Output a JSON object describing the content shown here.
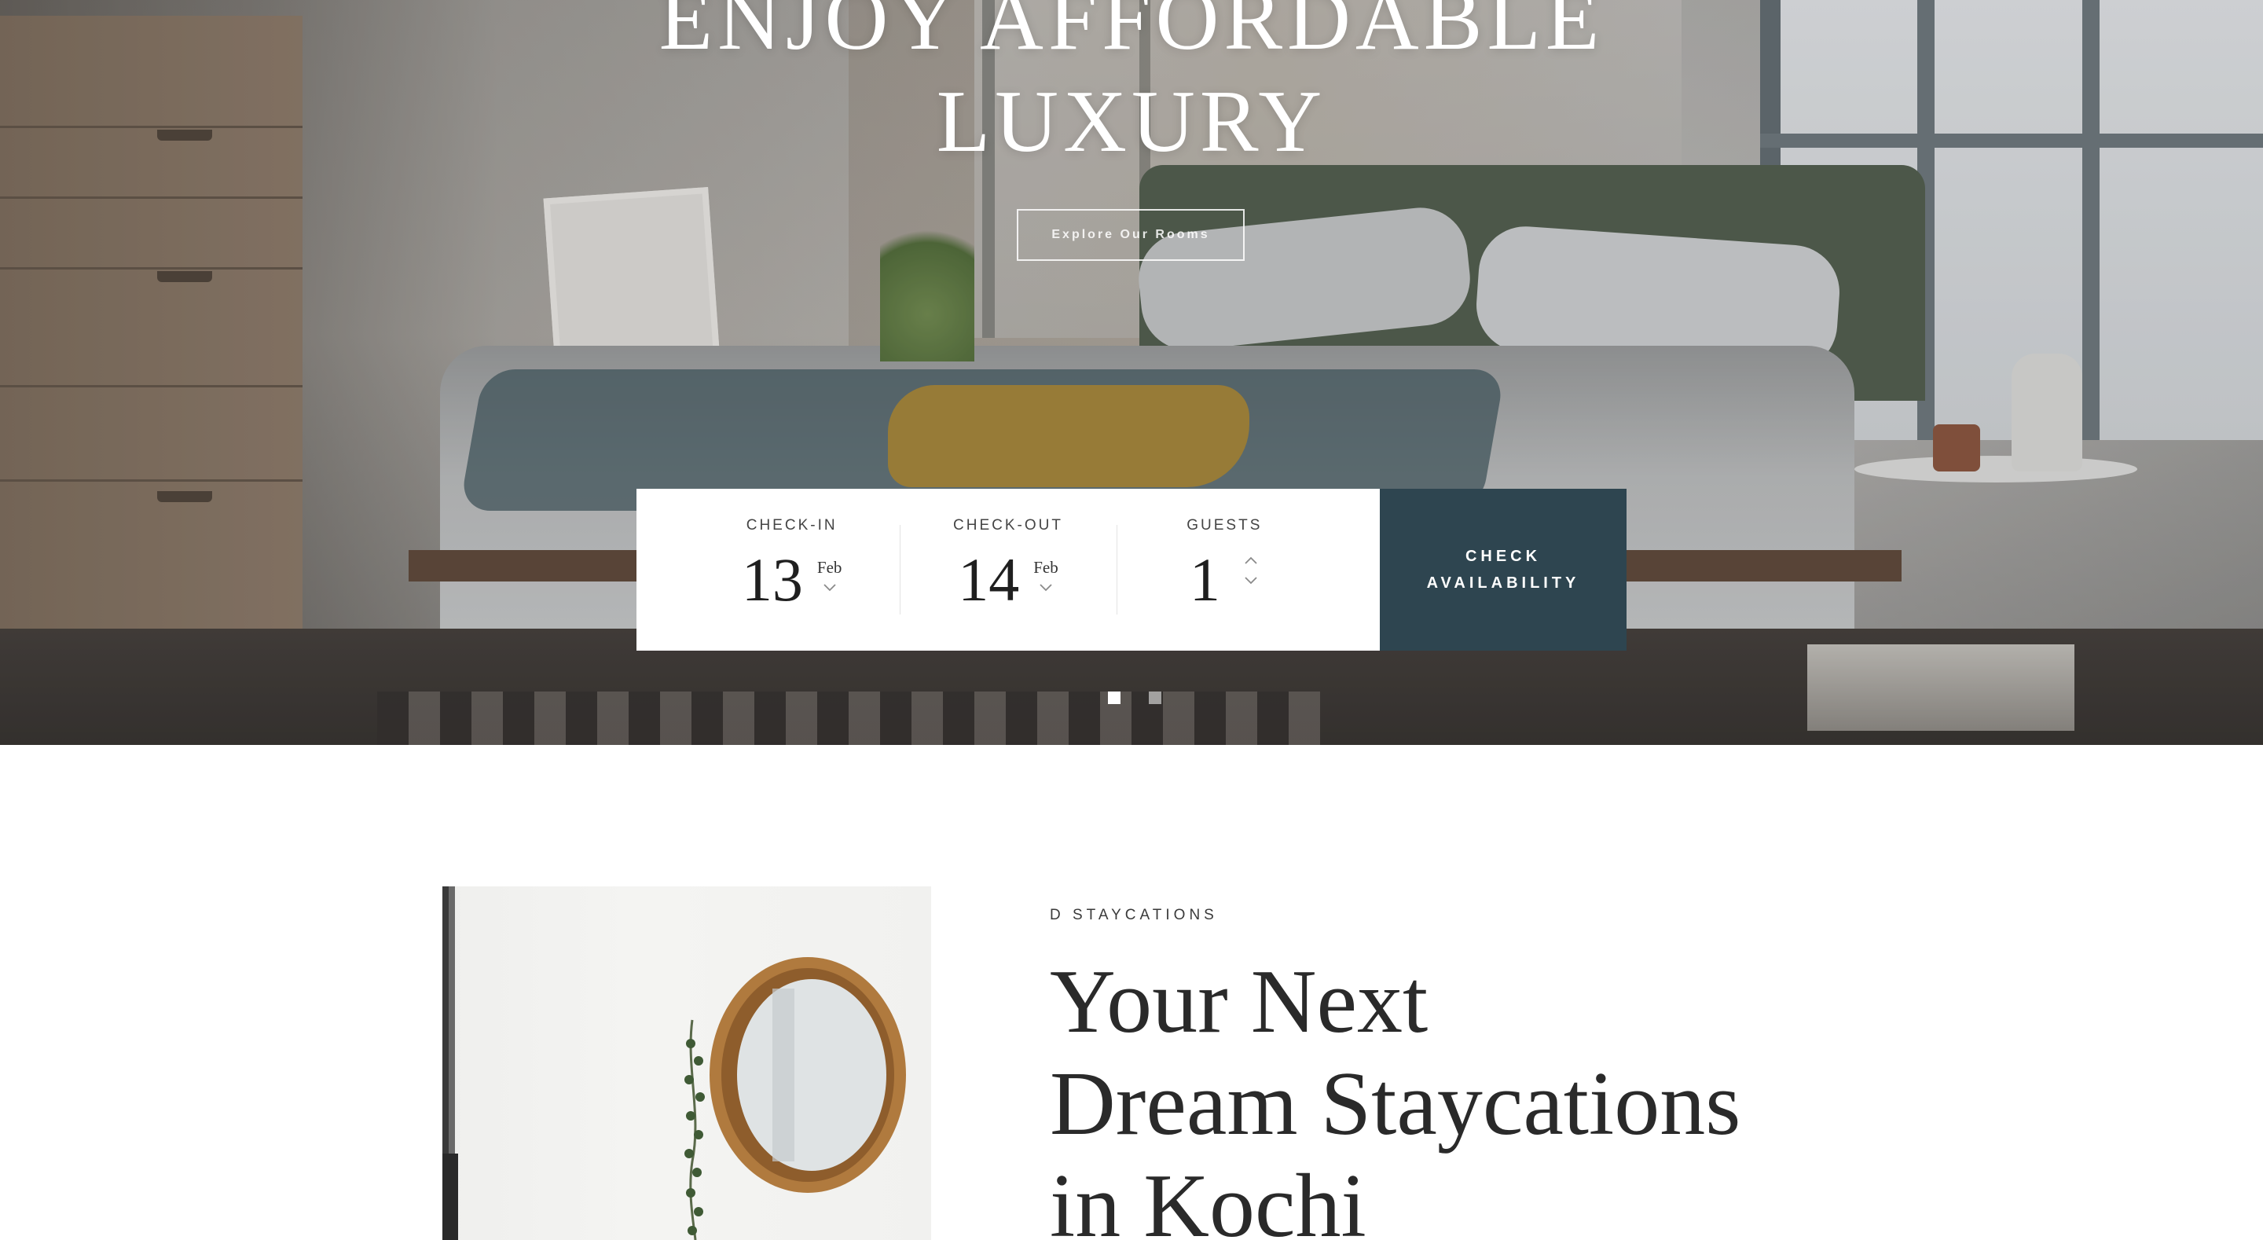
{
  "hero": {
    "title_line1": "ENJOY AFFORDABLE",
    "title_line2": "LUXURY",
    "explore_label": "Explore Our Rooms",
    "slides": {
      "count": 2,
      "active_index": 0
    }
  },
  "booking": {
    "checkin": {
      "label": "CHECK-IN",
      "day": "13",
      "month": "Feb"
    },
    "checkout": {
      "label": "CHECK-OUT",
      "day": "14",
      "month": "Feb"
    },
    "guests": {
      "label": "GUESTS",
      "value": "1"
    },
    "button_line1": "CHECK",
    "button_line2": "AVAILABILITY"
  },
  "about": {
    "eyebrow": "D STAYCATIONS",
    "heading_line1": "Your Next",
    "heading_line2": "Dream Staycations",
    "heading_line3": "in Kochi"
  },
  "colors": {
    "accent": "#2e4550",
    "white": "#ffffff",
    "text": "#2a2a2a"
  },
  "icons": [
    "chevron-down-icon",
    "chevron-up-icon"
  ]
}
